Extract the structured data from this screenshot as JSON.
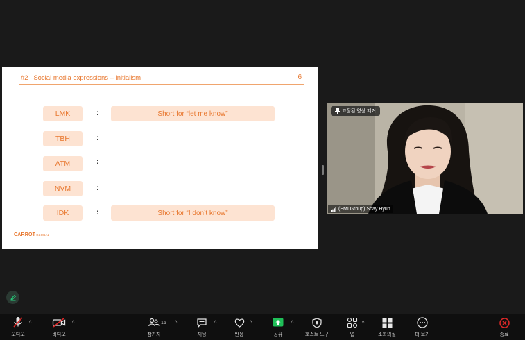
{
  "slide": {
    "title": "#2 | Social media expressions – initialism",
    "page": "6",
    "rows": [
      {
        "term": "LMK",
        "colon": ":",
        "meaning": "Short for “let me know”"
      },
      {
        "term": "TBH",
        "colon": ":",
        "meaning": ""
      },
      {
        "term": "ATM",
        "colon": ":",
        "meaning": ""
      },
      {
        "term": "NVM",
        "colon": ":",
        "meaning": ""
      },
      {
        "term": "IDK",
        "colon": ":",
        "meaning": "Short for “I don’t know”"
      }
    ],
    "brand": "CARROT",
    "brand_sub": "GLOBAL"
  },
  "video": {
    "pin_label": "고정된 영상 제거",
    "participant_name": "(EMI Group) Shay Hyun"
  },
  "toolbar": {
    "audio_label": "오디오",
    "video_label": "비디오",
    "participants_label": "참가자",
    "participants_count": "15",
    "chat_label": "채팅",
    "reactions_label": "반응",
    "share_label": "공유",
    "host_tools_label": "호스트 도구",
    "apps_label": "앱",
    "breakout_label": "소회의실",
    "more_label": "더 보기",
    "end_label": "종료"
  },
  "colors": {
    "accent": "#e8772e",
    "term_bg": "#fde3d2",
    "share_green": "#1fbf58",
    "end_red": "#e02828"
  }
}
